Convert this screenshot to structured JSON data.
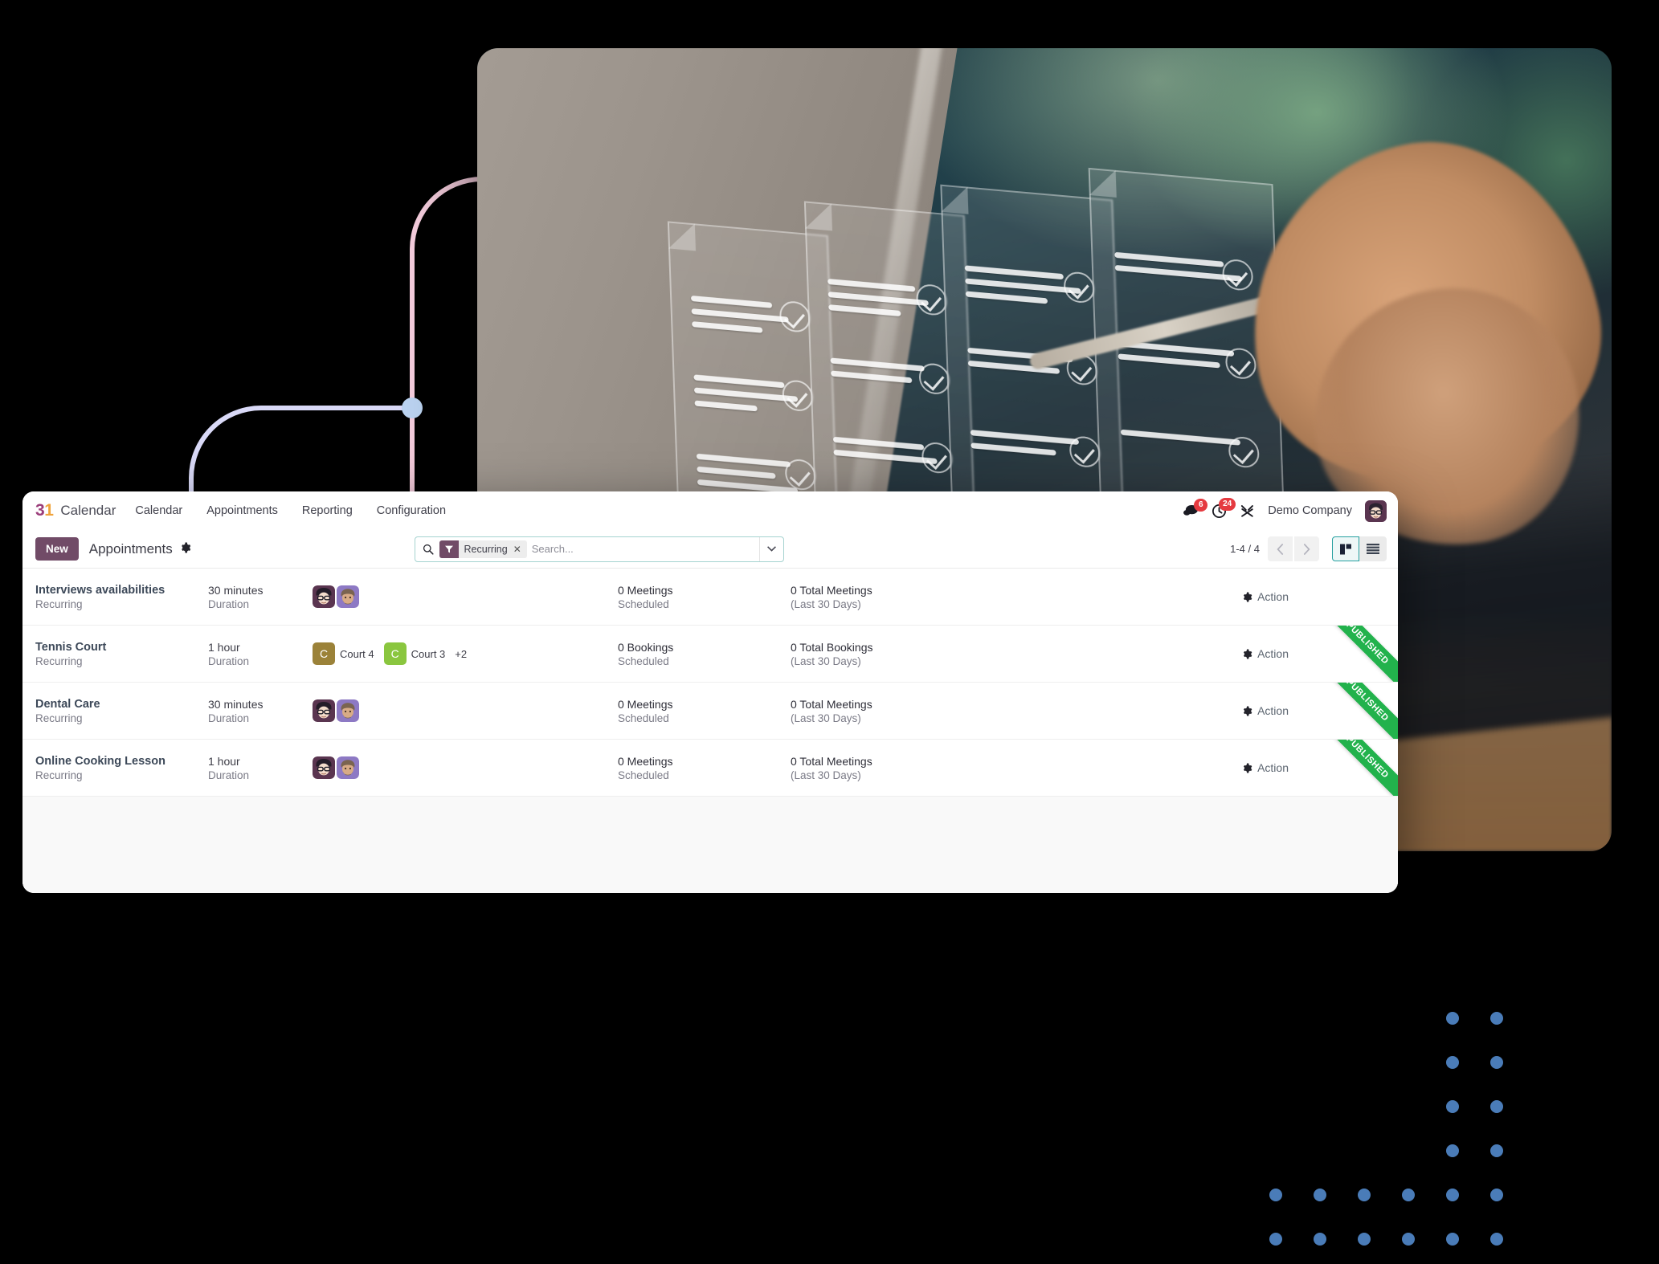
{
  "brand": {
    "logo_day": "31",
    "logo_digit_3": "3",
    "logo_digit_1": "1",
    "name": "Calendar",
    "logo_color_3": "#9b3d7a",
    "logo_color_1": "#f0a33c"
  },
  "nav": {
    "links": [
      {
        "label": "Calendar"
      },
      {
        "label": "Appointments"
      },
      {
        "label": "Reporting"
      },
      {
        "label": "Configuration"
      }
    ],
    "messages_badge": "6",
    "activities_badge": "24",
    "company": "Demo Company"
  },
  "control_panel": {
    "new_label": "New",
    "title": "Appointments",
    "pager": "1-4 / 4",
    "prev_label": "‹",
    "next_label": "›"
  },
  "search": {
    "facet_label": "Recurring",
    "facet_remove": "✕",
    "placeholder": "Search...",
    "value": ""
  },
  "colors": {
    "accent_purple": "#714b67",
    "accent_teal": "#25a0a0",
    "badge_red": "#e53a40",
    "ribbon_green": "#22b24c",
    "dots_blue": "#4a7cb8",
    "deco_pink": "#f6cede",
    "deco_lavender": "#d9d9f7"
  },
  "rows": [
    {
      "name": "Interviews availabilities",
      "subtitle": "Recurring",
      "duration": "30 minutes",
      "duration_label": "Duration",
      "resources_type": "avatars",
      "avatars": [
        {
          "type": "person",
          "bg": "#5a3550"
        },
        {
          "type": "person",
          "bg": "#8d79c4"
        }
      ],
      "chips": [],
      "more": "",
      "scheduled_count": "0 Meetings",
      "scheduled_label": "Scheduled",
      "total_count": "0 Total Meetings",
      "total_label": "(Last 30 Days)",
      "action_label": "Action",
      "ribbon": ""
    },
    {
      "name": "Tennis Court",
      "subtitle": "Recurring",
      "duration": "1 hour",
      "duration_label": "Duration",
      "resources_type": "chips",
      "avatars": [],
      "chips": [
        {
          "initial": "C",
          "label": "Court 4",
          "bg": "#9b8239"
        },
        {
          "initial": "C",
          "label": "Court 3",
          "bg": "#8ac63f"
        }
      ],
      "more": "+2",
      "scheduled_count": "0 Bookings",
      "scheduled_label": "Scheduled",
      "total_count": "0 Total Bookings",
      "total_label": "(Last 30 Days)",
      "action_label": "Action",
      "ribbon": "PUBLISHED"
    },
    {
      "name": "Dental Care",
      "subtitle": "Recurring",
      "duration": "30 minutes",
      "duration_label": "Duration",
      "resources_type": "avatars",
      "avatars": [
        {
          "type": "person",
          "bg": "#5a3550"
        },
        {
          "type": "person",
          "bg": "#8d79c4"
        }
      ],
      "chips": [],
      "more": "",
      "scheduled_count": "0 Meetings",
      "scheduled_label": "Scheduled",
      "total_count": "0 Total Meetings",
      "total_label": "(Last 30 Days)",
      "action_label": "Action",
      "ribbon": "PUBLISHED"
    },
    {
      "name": "Online Cooking Lesson",
      "subtitle": "Recurring",
      "duration": "1 hour",
      "duration_label": "Duration",
      "resources_type": "avatars",
      "avatars": [
        {
          "type": "person",
          "bg": "#5a3550"
        },
        {
          "type": "person",
          "bg": "#8d79c4"
        }
      ],
      "chips": [],
      "more": "",
      "scheduled_count": "0 Meetings",
      "scheduled_label": "Scheduled",
      "total_count": "0 Total Meetings",
      "total_label": "(Last 30 Days)",
      "action_label": "Action",
      "ribbon": "PUBLISHED"
    }
  ]
}
